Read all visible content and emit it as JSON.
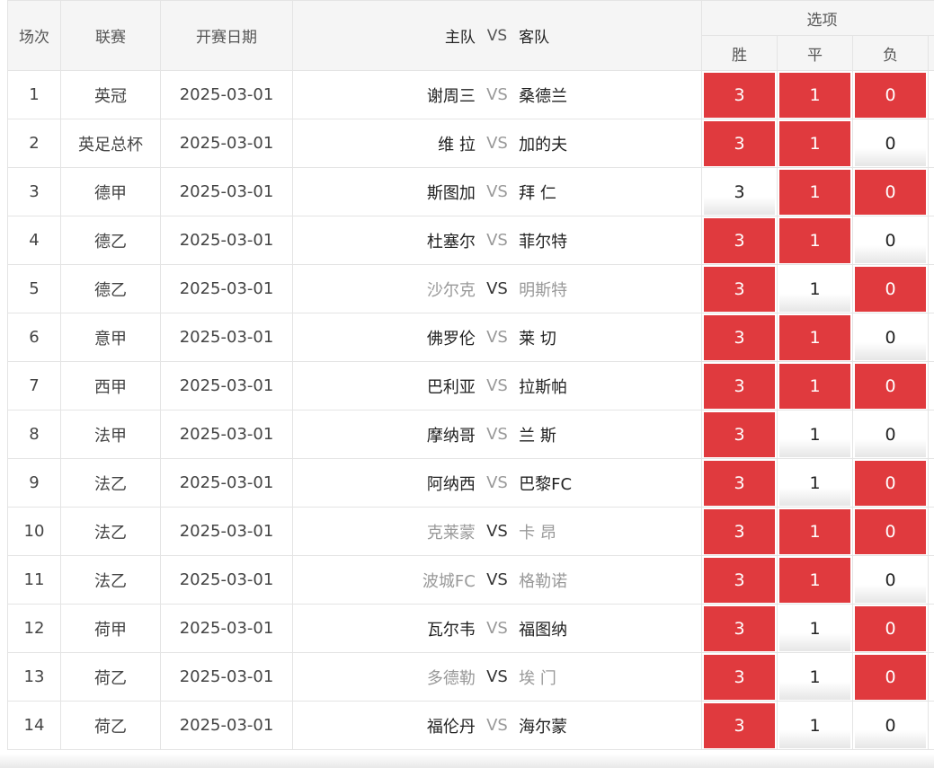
{
  "headers": {
    "no": "场次",
    "league": "联赛",
    "date": "开赛日期",
    "home": "主队",
    "vs": "VS",
    "away": "客队",
    "options": "选项",
    "win": "胜",
    "draw": "平",
    "lose": "负"
  },
  "colors": {
    "selected_bg": "#e03a3e",
    "selected_text": "#ffffff",
    "unselected_text": "#222222",
    "dim_team_text": "#999999"
  },
  "rows": [
    {
      "no": "1",
      "league": "英冠",
      "date": "2025-03-01",
      "home": "谢周三",
      "vs": "VS",
      "away": "桑德兰",
      "dim": false,
      "win": "3",
      "draw": "1",
      "lose": "0",
      "win_selected": true,
      "draw_selected": true,
      "lose_selected": true
    },
    {
      "no": "2",
      "league": "英足总杯",
      "date": "2025-03-01",
      "home": "维 拉",
      "vs": "VS",
      "away": "加的夫",
      "dim": false,
      "win": "3",
      "draw": "1",
      "lose": "0",
      "win_selected": true,
      "draw_selected": true,
      "lose_selected": false
    },
    {
      "no": "3",
      "league": "德甲",
      "date": "2025-03-01",
      "home": "斯图加",
      "vs": "VS",
      "away": "拜 仁",
      "dim": false,
      "win": "3",
      "draw": "1",
      "lose": "0",
      "win_selected": false,
      "draw_selected": true,
      "lose_selected": true
    },
    {
      "no": "4",
      "league": "德乙",
      "date": "2025-03-01",
      "home": "杜塞尔",
      "vs": "VS",
      "away": "菲尔特",
      "dim": false,
      "win": "3",
      "draw": "1",
      "lose": "0",
      "win_selected": true,
      "draw_selected": true,
      "lose_selected": false
    },
    {
      "no": "5",
      "league": "德乙",
      "date": "2025-03-01",
      "home": "沙尔克",
      "vs": "VS",
      "away": "明斯特",
      "dim": true,
      "win": "3",
      "draw": "1",
      "lose": "0",
      "win_selected": true,
      "draw_selected": false,
      "lose_selected": true
    },
    {
      "no": "6",
      "league": "意甲",
      "date": "2025-03-01",
      "home": "佛罗伦",
      "vs": "VS",
      "away": "莱 切",
      "dim": false,
      "win": "3",
      "draw": "1",
      "lose": "0",
      "win_selected": true,
      "draw_selected": true,
      "lose_selected": false
    },
    {
      "no": "7",
      "league": "西甲",
      "date": "2025-03-01",
      "home": "巴利亚",
      "vs": "VS",
      "away": "拉斯帕",
      "dim": false,
      "win": "3",
      "draw": "1",
      "lose": "0",
      "win_selected": true,
      "draw_selected": true,
      "lose_selected": true
    },
    {
      "no": "8",
      "league": "法甲",
      "date": "2025-03-01",
      "home": "摩纳哥",
      "vs": "VS",
      "away": "兰 斯",
      "dim": false,
      "win": "3",
      "draw": "1",
      "lose": "0",
      "win_selected": true,
      "draw_selected": false,
      "lose_selected": false
    },
    {
      "no": "9",
      "league": "法乙",
      "date": "2025-03-01",
      "home": "阿纳西",
      "vs": "VS",
      "away": "巴黎FC",
      "dim": false,
      "win": "3",
      "draw": "1",
      "lose": "0",
      "win_selected": true,
      "draw_selected": false,
      "lose_selected": true
    },
    {
      "no": "10",
      "league": "法乙",
      "date": "2025-03-01",
      "home": "克莱蒙",
      "vs": "VS",
      "away": "卡 昂",
      "dim": true,
      "win": "3",
      "draw": "1",
      "lose": "0",
      "win_selected": true,
      "draw_selected": true,
      "lose_selected": true
    },
    {
      "no": "11",
      "league": "法乙",
      "date": "2025-03-01",
      "home": "波城FC",
      "vs": "VS",
      "away": "格勒诺",
      "dim": true,
      "win": "3",
      "draw": "1",
      "lose": "0",
      "win_selected": true,
      "draw_selected": true,
      "lose_selected": false
    },
    {
      "no": "12",
      "league": "荷甲",
      "date": "2025-03-01",
      "home": "瓦尔韦",
      "vs": "VS",
      "away": "福图纳",
      "dim": false,
      "win": "3",
      "draw": "1",
      "lose": "0",
      "win_selected": true,
      "draw_selected": false,
      "lose_selected": true
    },
    {
      "no": "13",
      "league": "荷乙",
      "date": "2025-03-01",
      "home": "多德勒",
      "vs": "VS",
      "away": "埃 门",
      "dim": true,
      "win": "3",
      "draw": "1",
      "lose": "0",
      "win_selected": true,
      "draw_selected": false,
      "lose_selected": true
    },
    {
      "no": "14",
      "league": "荷乙",
      "date": "2025-03-01",
      "home": "福伦丹",
      "vs": "VS",
      "away": "海尔蒙",
      "dim": false,
      "win": "3",
      "draw": "1",
      "lose": "0",
      "win_selected": true,
      "draw_selected": false,
      "lose_selected": false
    }
  ]
}
